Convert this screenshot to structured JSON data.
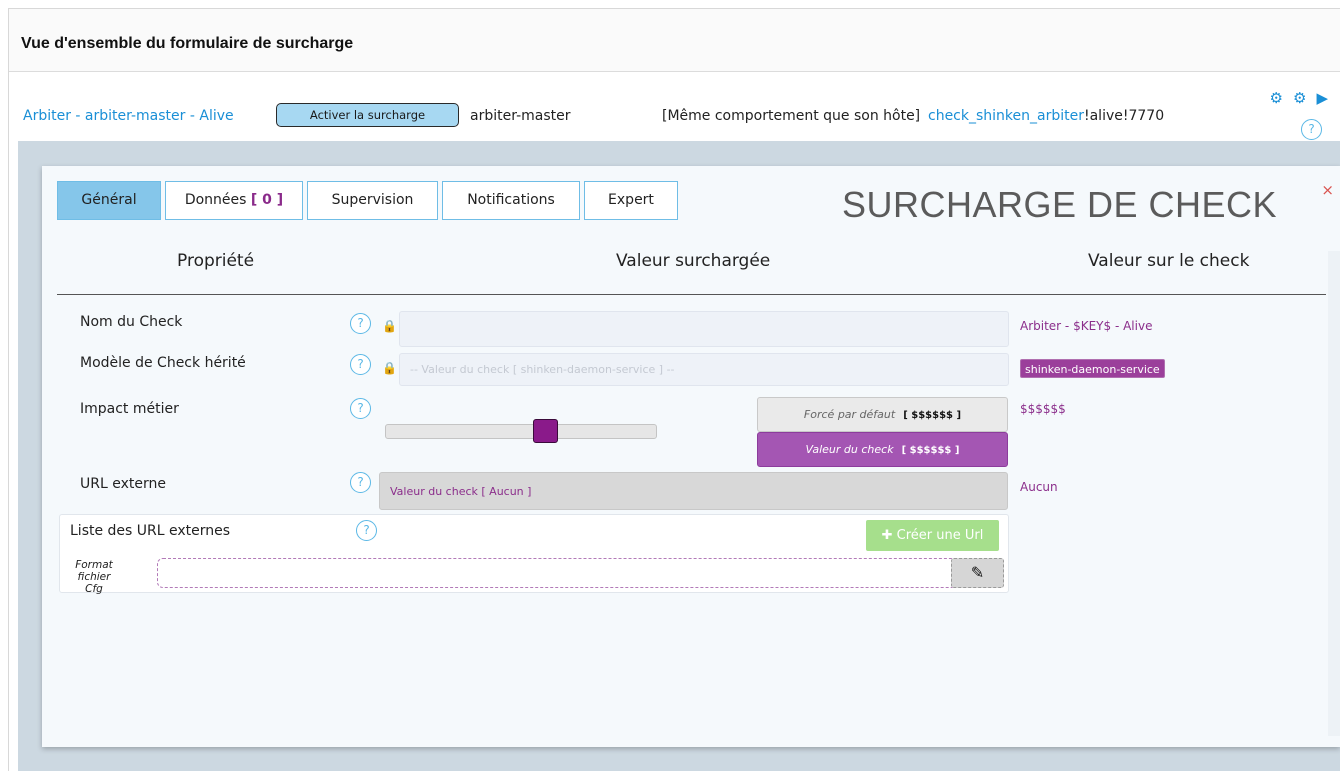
{
  "page": {
    "title": "Vue d'ensemble du formulaire de surcharge"
  },
  "summary": {
    "check_name": "Arbiter - arbiter-master - Alive",
    "activate_button": "Activer la surcharge",
    "host": "arbiter-master",
    "behaviour": "[Même comportement que son hôte]",
    "command_link": "check_shinken_arbiter",
    "command_args": "!alive!7770",
    "icons": [
      "gear-icon",
      "gear-refresh-icon",
      "play-icon"
    ],
    "help": "?"
  },
  "panel": {
    "close": "×",
    "title": "SURCHARGE DE CHECK",
    "tabs": [
      {
        "label": "Général",
        "active": true
      },
      {
        "label": "Données",
        "count": "[ 0 ]"
      },
      {
        "label": "Supervision"
      },
      {
        "label": "Notifications"
      },
      {
        "label": "Expert"
      }
    ],
    "columns": {
      "property": "Propriété",
      "override": "Valeur surchargée",
      "check_value": "Valeur sur le check"
    },
    "rows": {
      "check_name": {
        "label": "Nom du Check",
        "check_value": "Arbiter - $KEY$ - Alive"
      },
      "template": {
        "label": "Modèle de Check hérité",
        "placeholder": "-- Valeur du check [ shinken-daemon-service ] --",
        "check_value": "shinken-daemon-service"
      },
      "impact": {
        "label": "Impact métier",
        "forced_label": "Forcé par défaut",
        "forced_value": "[ $$$$$$ ]",
        "check_label": "Valeur du check",
        "check_btn_value": "[ $$$$$$ ]",
        "check_value": "$$$$$$",
        "slider_level": 0.6
      },
      "external_url": {
        "label": "URL externe",
        "value": "Valeur du check [ Aucun ]",
        "check_value": "Aucun"
      },
      "url_list": {
        "label": "Liste des URL externes",
        "create_button": "Créer une Url",
        "format_label_line1": "Format fichier",
        "format_label_line2": "Cfg"
      }
    }
  },
  "colors": {
    "accent_blue": "#1a8fd6",
    "purple": "#8b2e8b",
    "tab_active": "#85c6ea",
    "create_green": "#a6df8c"
  }
}
